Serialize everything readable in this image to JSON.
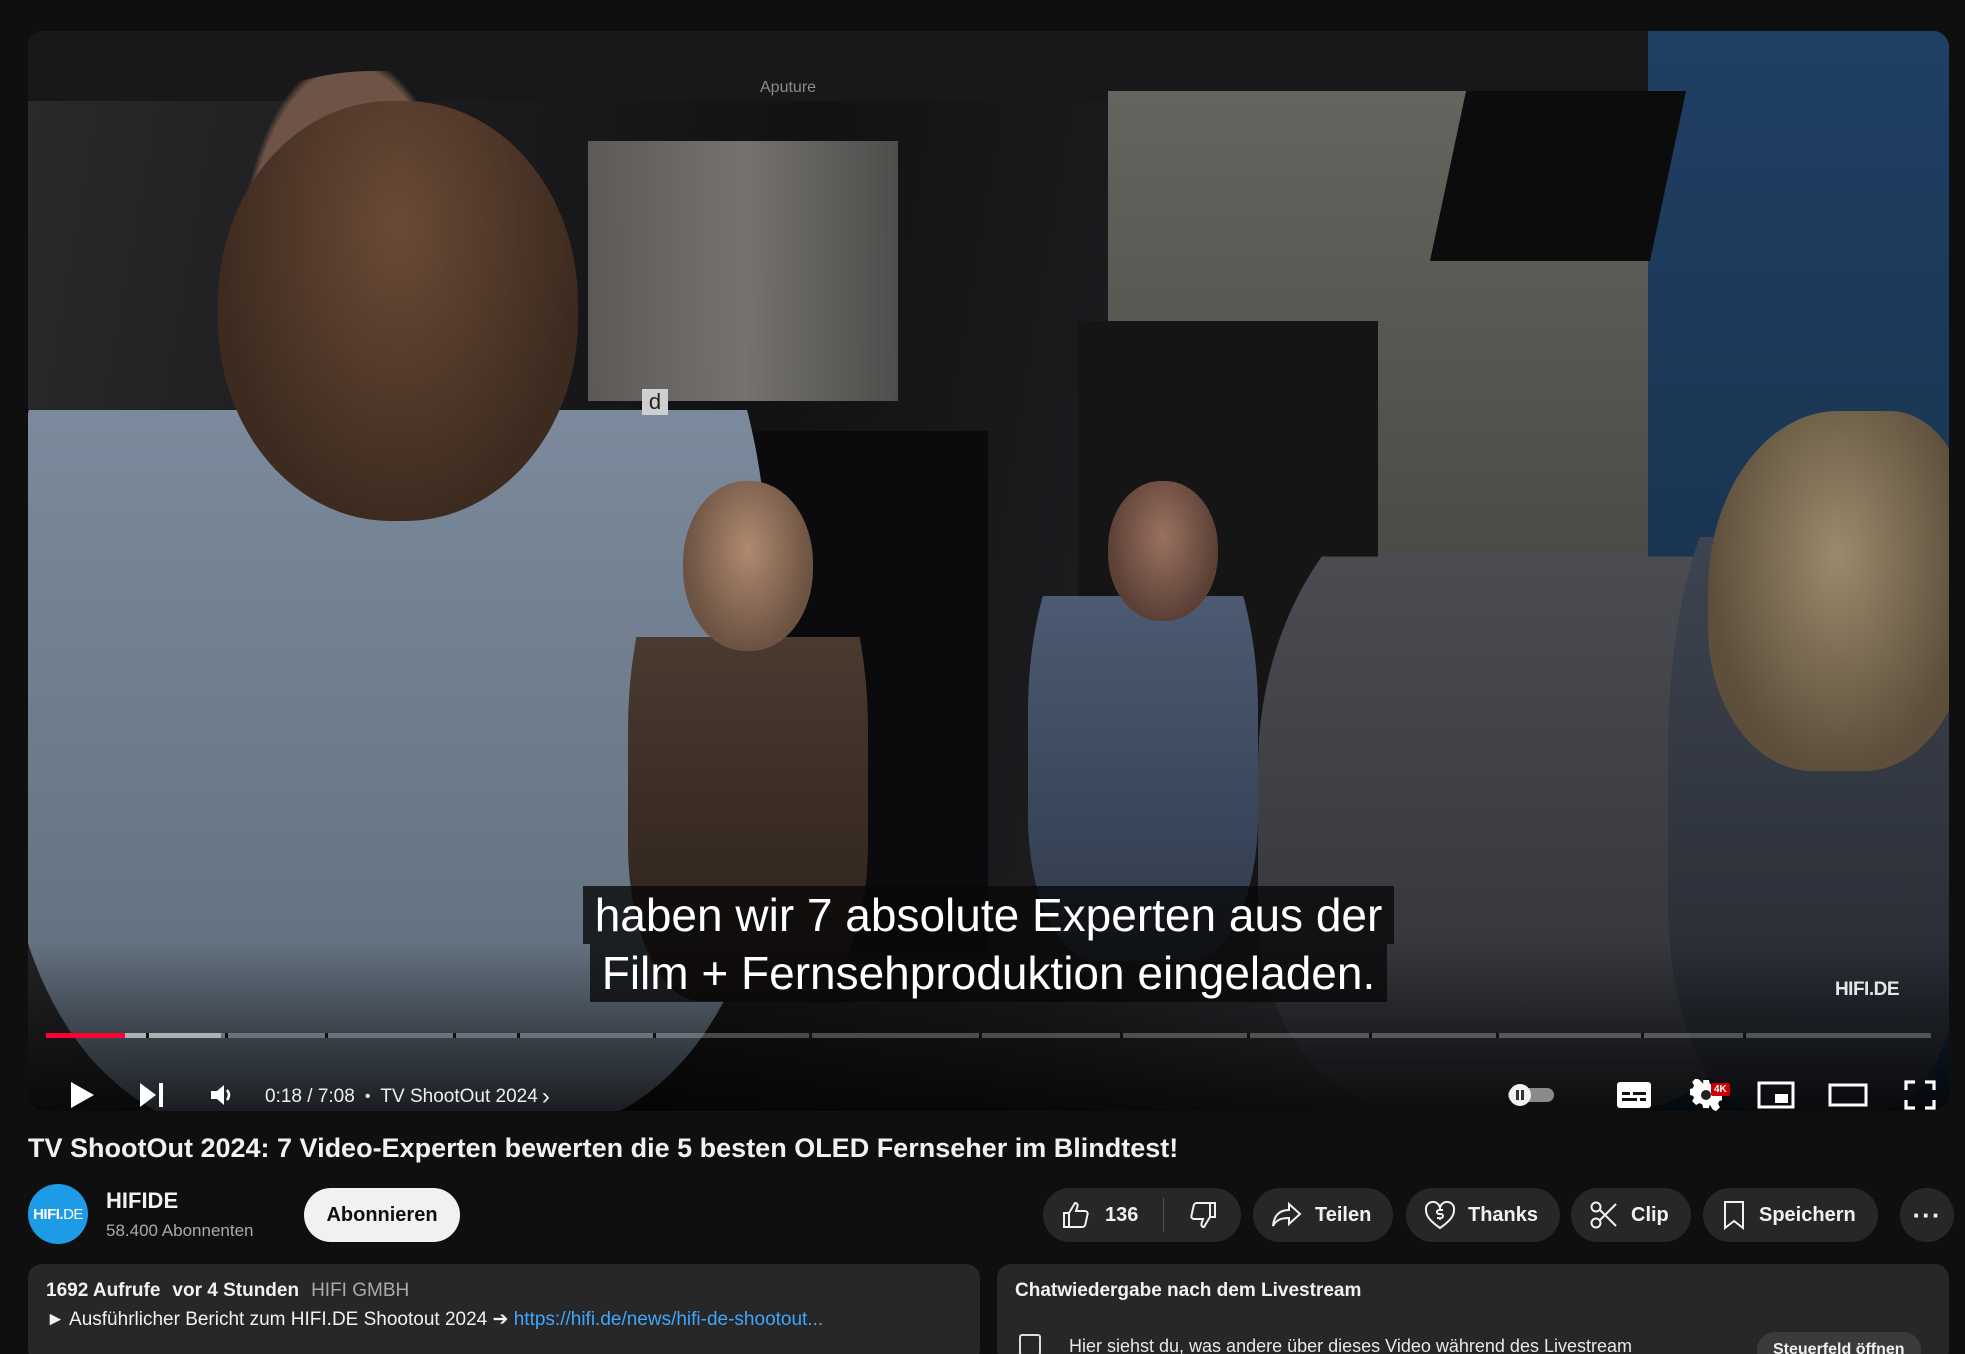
{
  "player": {
    "subtitle_line1": "haben wir 7 absolute Experten aus der",
    "subtitle_line2": "Film + Fernsehproduktion eingeladen.",
    "watermark": "HIFI.DE",
    "scene_sign_letter": "d",
    "scene_brand_text": "Aputure",
    "time_current": "0:18",
    "time_separator": " / ",
    "time_total": "7:08",
    "chapter_dot": "•",
    "chapter_title": "TV ShootOut 2024",
    "chapter_chevron": "›",
    "progress_played": 0.042,
    "progress_buffered": 0.093,
    "settings_badge": "4K",
    "accent_color": "#ff0033"
  },
  "video": {
    "title": "TV ShootOut 2024: 7 Video-Experten bewerten die 5 besten OLED Fernseher im Blindtest!"
  },
  "channel": {
    "avatar_text_bold": "HIFI.",
    "avatar_text_light": "DE",
    "name": "HIFIDE",
    "subscribers": "58.400 Abonnenten",
    "subscribe_label": "Abonnieren"
  },
  "actions": {
    "like_count": "136",
    "share_label": "Teilen",
    "thanks_label": "Thanks",
    "clip_label": "Clip",
    "save_label": "Speichern",
    "more_label": "···"
  },
  "description": {
    "views": "1692 Aufrufe",
    "age": "vor 4 Stunden",
    "owner": "HIFI GMBH",
    "line1_prefix": "► Ausführlicher Bericht zum HIFI.DE Shootout 2024 ➔",
    "line1_link": "https://hifi.de/news/hifi-de-shootout..."
  },
  "chat": {
    "title": "Chatwiedergabe nach dem Livestream",
    "body": "Hier siehst du, was andere über dieses Video während des Livestream",
    "open_button": "Steuerfeld öffnen"
  }
}
